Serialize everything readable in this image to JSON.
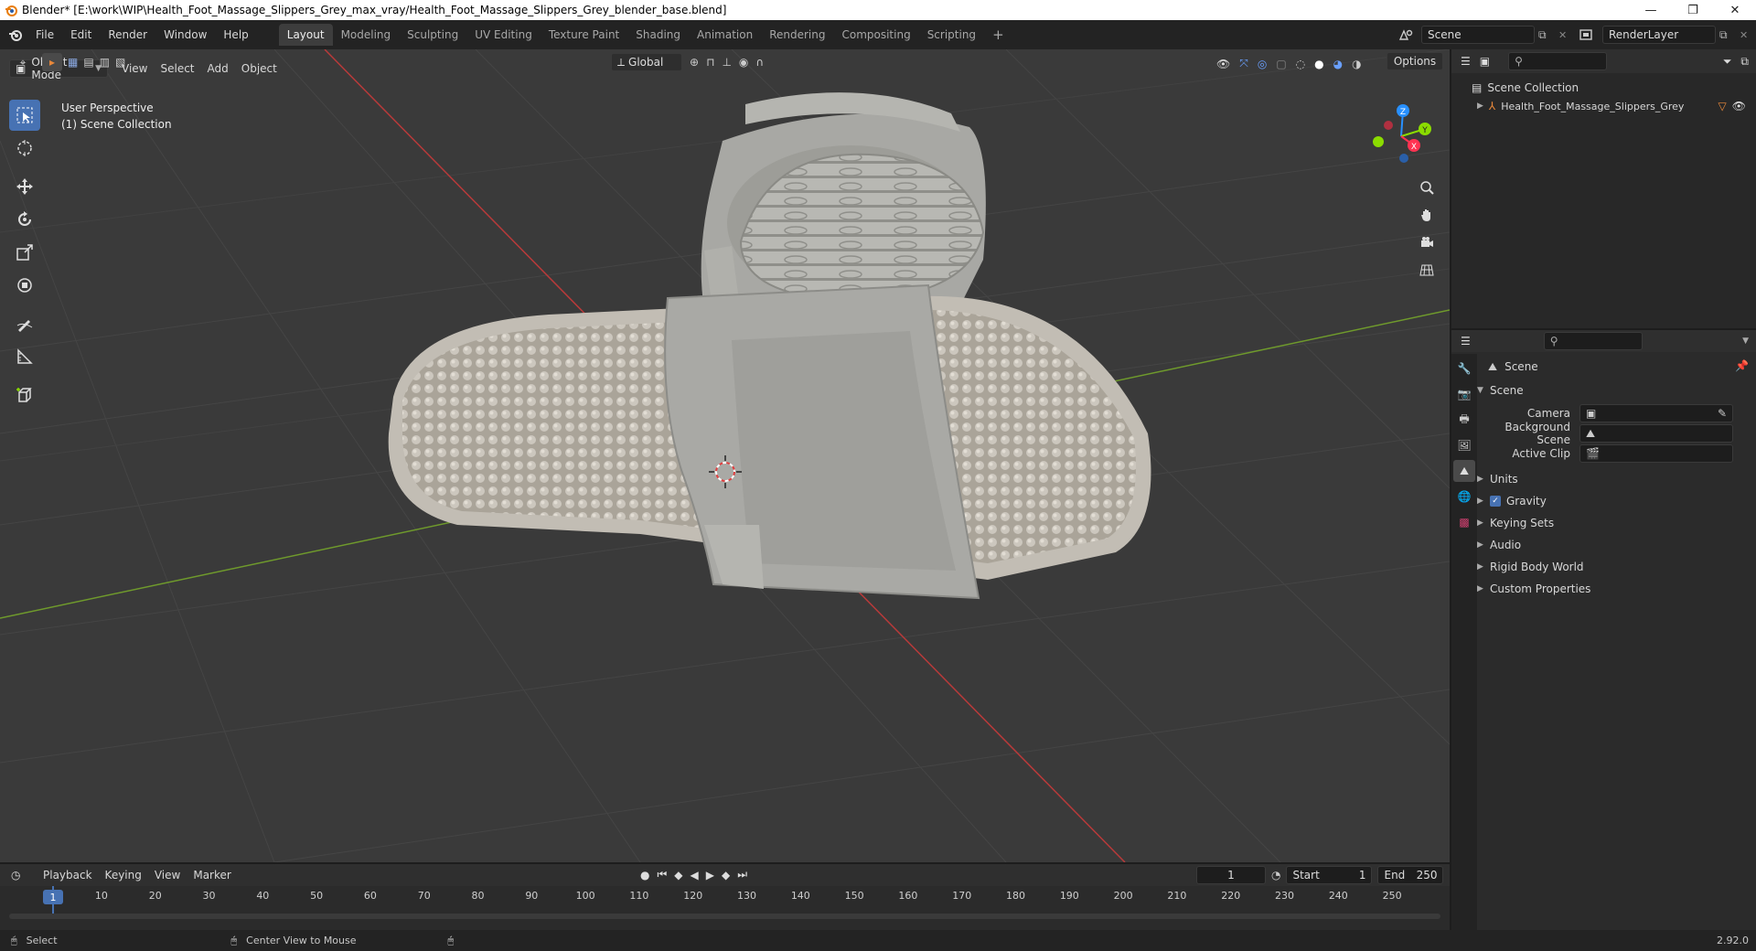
{
  "window": {
    "title": "Blender* [E:\\work\\WIP\\Health_Foot_Massage_Slippers_Grey_max_vray/Health_Foot_Massage_Slippers_Grey_blender_base.blend]",
    "minimize": "—",
    "restore": "❐",
    "close": "✕"
  },
  "menu": {
    "items": [
      "File",
      "Edit",
      "Render",
      "Window",
      "Help"
    ]
  },
  "workspaces": {
    "tabs": [
      "Layout",
      "Modeling",
      "Sculpting",
      "UV Editing",
      "Texture Paint",
      "Shading",
      "Animation",
      "Rendering",
      "Compositing",
      "Scripting"
    ],
    "active": "Layout",
    "add": "+"
  },
  "scene_selector": {
    "value": "Scene"
  },
  "renderlayer_selector": {
    "value": "RenderLayer"
  },
  "viewport_header": {
    "mode": "Object Mode",
    "view": "View",
    "select": "Select",
    "add": "Add",
    "object": "Object",
    "transform_orientation": "Global",
    "options": "Options"
  },
  "viewport": {
    "perspective_label": "User Perspective",
    "collection_label": "(1) Scene Collection",
    "gizmo": {
      "x": "X",
      "y": "Y",
      "z": "Z"
    }
  },
  "outliner": {
    "root": "Scene Collection",
    "items": [
      "Health_Foot_Massage_Slippers_Grey"
    ]
  },
  "properties": {
    "context": "Scene",
    "panel_title": "Scene",
    "camera_label": "Camera",
    "background_scene_label": "Background Scene",
    "active_clip_label": "Active Clip",
    "subpanels": [
      "Units",
      "Gravity",
      "Keying Sets",
      "Audio",
      "Rigid Body World",
      "Custom Properties"
    ],
    "gravity_checked": true
  },
  "timeline": {
    "playback": "Playback",
    "keying": "Keying",
    "view": "View",
    "marker": "Marker",
    "current_frame": "1",
    "start_label": "Start",
    "start_value": "1",
    "end_label": "End",
    "end_value": "250",
    "ticks": [
      "1",
      "10",
      "20",
      "30",
      "40",
      "50",
      "60",
      "70",
      "80",
      "90",
      "100",
      "110",
      "120",
      "130",
      "140",
      "150",
      "160",
      "170",
      "180",
      "190",
      "200",
      "210",
      "220",
      "230",
      "240",
      "250"
    ]
  },
  "statusbar": {
    "select": "Select",
    "center_view": "Center View to Mouse",
    "version": "2.92.0"
  },
  "colors": {
    "accent_blue": "#4772b3",
    "viewport_bg": "#393939",
    "axis_x": "#b83a3a",
    "axis_y": "#6f9a2c",
    "gizmo_x": "#ff3352",
    "gizmo_y": "#8bdc00",
    "gizmo_z": "#2890ff",
    "object_orange": "#e8883a"
  }
}
